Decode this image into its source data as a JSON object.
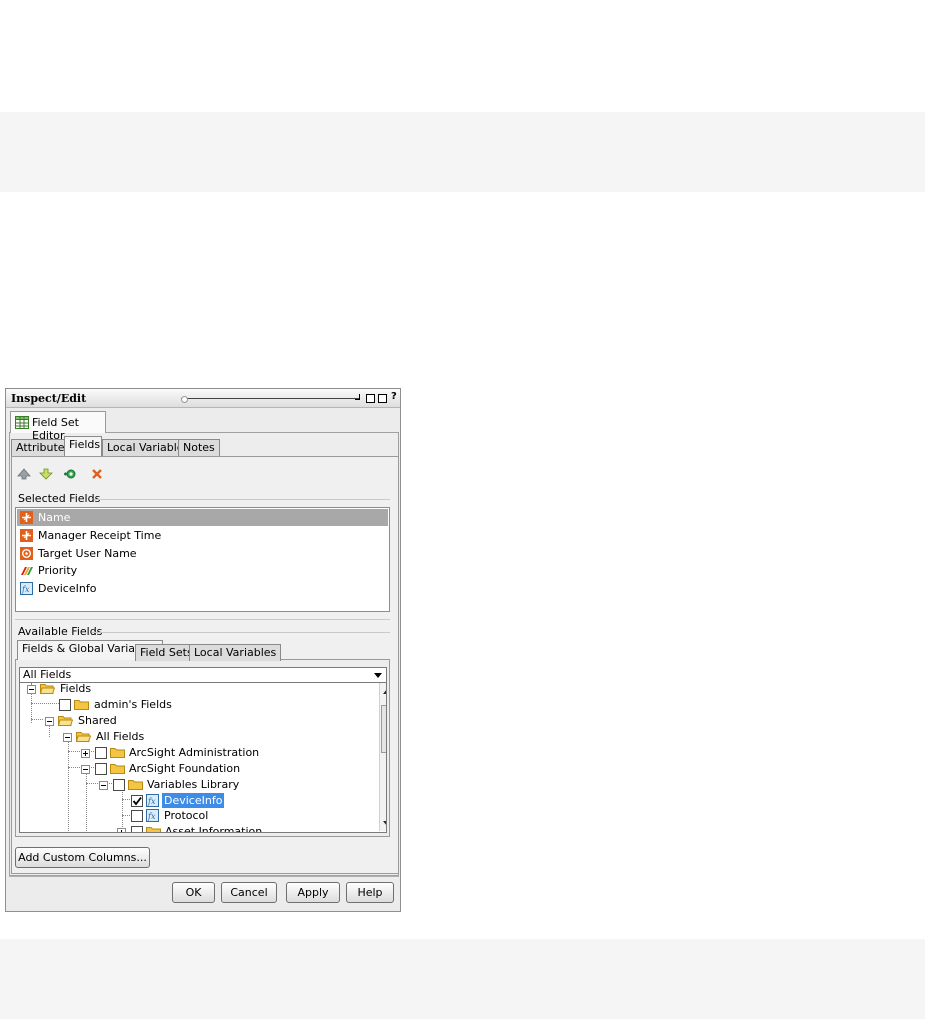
{
  "window": {
    "title": "Inspect/Edit",
    "help_glyph": "?"
  },
  "editor_tab": {
    "label": "Field Set Editor"
  },
  "tabs": [
    {
      "label": "Attributes",
      "active": false
    },
    {
      "label": "Fields",
      "active": true
    },
    {
      "label": "Local Variables",
      "active": false
    },
    {
      "label": "Notes",
      "active": false
    }
  ],
  "toolbar": {
    "icons": [
      "move-up-icon",
      "move-down-icon",
      "add-field-icon",
      "remove-icon"
    ]
  },
  "selected_fields": {
    "label": "Selected Fields",
    "items": [
      {
        "label": "Name",
        "icon": "event-field-icon",
        "selected": true
      },
      {
        "label": "Manager Receipt Time",
        "icon": "event-field-icon",
        "selected": false
      },
      {
        "label": "Target User Name",
        "icon": "target-field-icon",
        "selected": false
      },
      {
        "label": "Priority",
        "icon": "priority-icon",
        "selected": false
      },
      {
        "label": "DeviceInfo",
        "icon": "variable-icon",
        "selected": false
      }
    ]
  },
  "available_fields": {
    "label": "Available Fields",
    "tabs": [
      {
        "label": "Fields & Global Variables",
        "active": true
      },
      {
        "label": "Field Sets",
        "active": false
      },
      {
        "label": "Local Variables",
        "active": false
      }
    ],
    "filter_value": "All Fields",
    "tree": [
      {
        "label": "Fields",
        "expanded": true
      },
      {
        "label": "admin's Fields",
        "checked": false
      },
      {
        "label": "Shared",
        "expanded": true
      },
      {
        "label": "All Fields",
        "expanded": true
      },
      {
        "label": "ArcSight Administration",
        "checked": false
      },
      {
        "label": "ArcSight Foundation",
        "checked": false
      },
      {
        "label": "Variables Library",
        "checked": false
      },
      {
        "label": "DeviceInfo",
        "checked": true,
        "highlighted": true
      },
      {
        "label": "Protocol",
        "checked": false
      },
      {
        "label": "Asset Information",
        "checked": false
      }
    ]
  },
  "buttons": {
    "add_custom": "Add Custom Columns...",
    "ok": "OK",
    "cancel": "Cancel",
    "apply": "Apply",
    "help": "Help"
  },
  "colors": {
    "selection_gray": "#a8a8a8",
    "highlight_blue": "#3d8ce8",
    "event_icon_orange": "#e0601c",
    "folder_yellow": "#f4c542"
  }
}
